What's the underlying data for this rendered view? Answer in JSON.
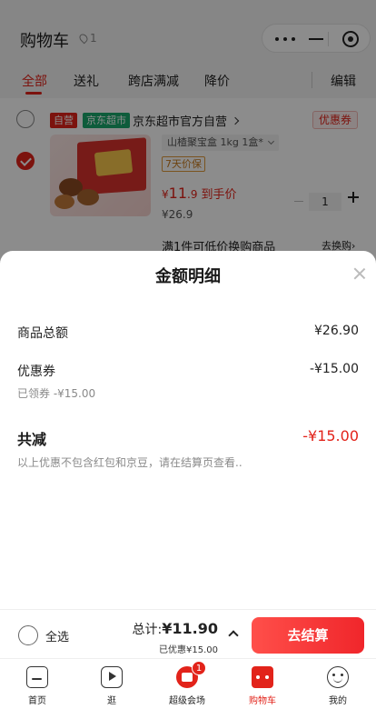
{
  "header": {
    "title": "购物车",
    "count": "1",
    "pin_icon": "location-pin-icon",
    "capsule_icons": [
      "more-dots-icon",
      "minimize-icon",
      "target-icon"
    ]
  },
  "tabs": {
    "items": [
      "全部",
      "送礼",
      "跨店满减",
      "降价"
    ],
    "active_index": 0,
    "edit_label": "编辑"
  },
  "shop": {
    "self_badge": "自营",
    "super_badge": "京东超市",
    "name": "京东超市官方自营",
    "coupon_label": "优惠券"
  },
  "product": {
    "spec": "山楂聚宝盒 1kg 1盒*",
    "guarantee": "7天价保",
    "price_symbol": "¥",
    "price_int": "11",
    "price_dec": ".9",
    "price_tail": "到手价",
    "original_price": "¥26.9",
    "quantity": "1",
    "promo_text": "满1件可低价换购商品",
    "promo_link": "去换购",
    "checked": true
  },
  "sheet": {
    "title": "金额明细",
    "goods_total_label": "商品总额",
    "goods_total_value": "¥26.90",
    "coupon_label": "优惠券",
    "coupon_value": "-¥15.00",
    "coupon_sub": "已领券 -¥15.00",
    "total_reduce_label": "共减",
    "total_reduce_value": "-¥15.00",
    "note": "以上优惠不包含红包和京豆，请在结算页查看.."
  },
  "checkout": {
    "select_all_label": "全选",
    "sum_label": "总计:",
    "sum_value": "¥11.90",
    "discount_text": "已优惠¥15.00",
    "button_label": "去结算"
  },
  "tabbar": {
    "items": [
      {
        "label": "首页",
        "icon": "home-icon"
      },
      {
        "label": "逛",
        "icon": "video-icon"
      },
      {
        "label": "超级会场",
        "icon": "super-venue-icon",
        "badge": "1"
      },
      {
        "label": "购物车",
        "icon": "cart-icon"
      },
      {
        "label": "我的",
        "icon": "profile-icon"
      }
    ],
    "active_index": 3
  },
  "colors": {
    "accent": "#e2231a",
    "supermarket_green": "#1aa86c"
  }
}
